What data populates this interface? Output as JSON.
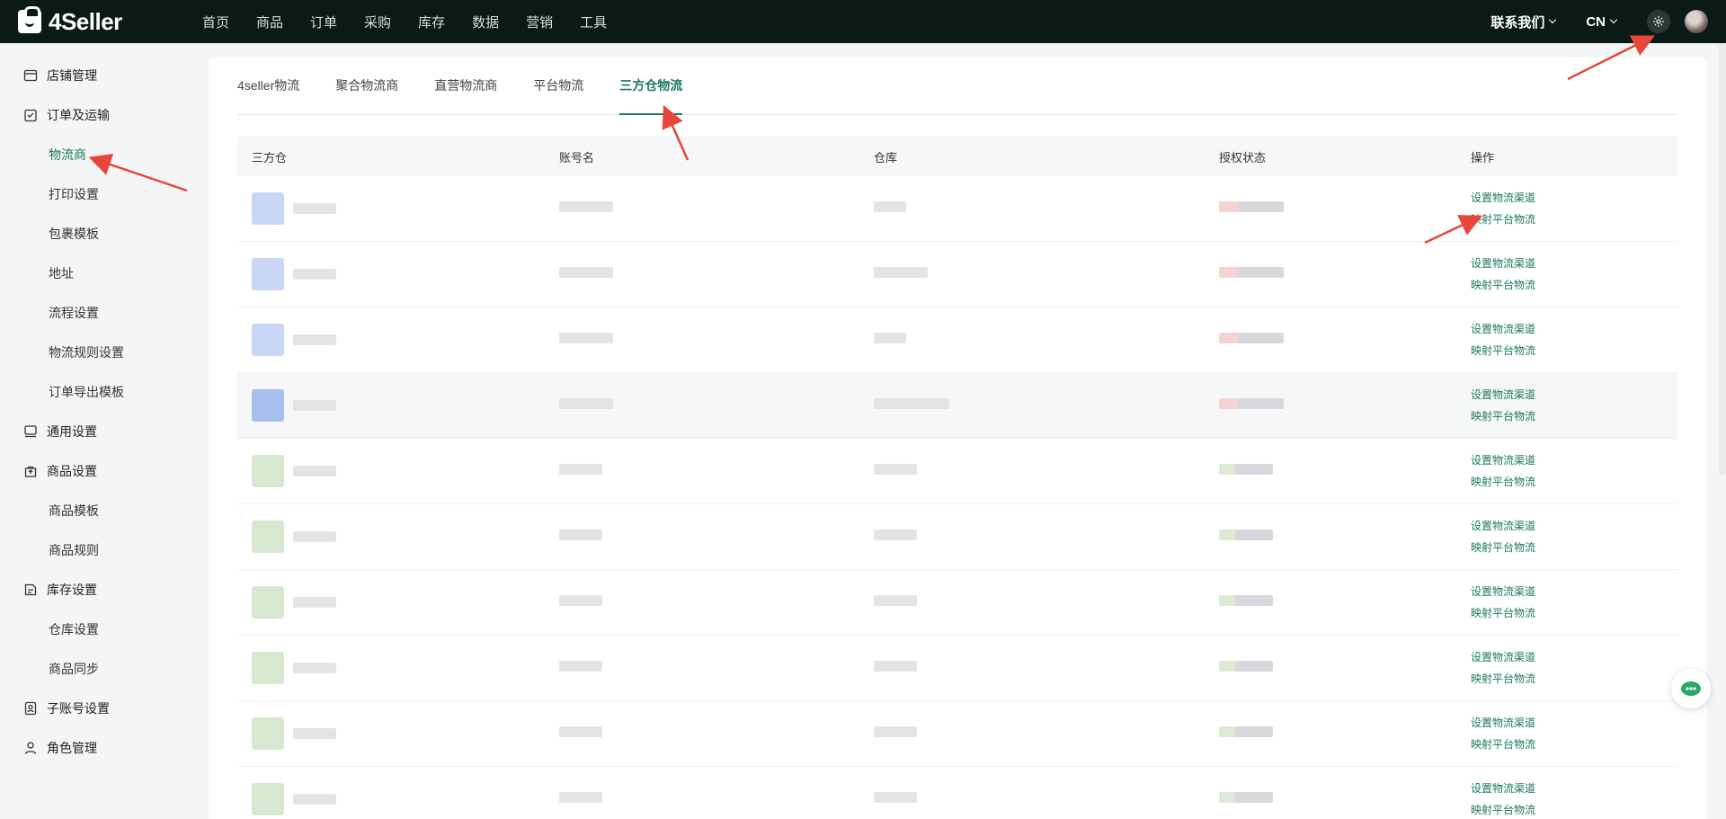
{
  "app": {
    "brand": "4Seller"
  },
  "nav": [
    "首页",
    "商品",
    "订单",
    "采购",
    "库存",
    "数据",
    "营销",
    "工具"
  ],
  "top_right": {
    "contact": "联系我们",
    "lang": "CN"
  },
  "sidebar": {
    "items": [
      {
        "label": "店铺管理",
        "icon": "shop-icon",
        "level": 0
      },
      {
        "label": "订单及运输",
        "icon": "order-icon",
        "level": 0
      },
      {
        "label": "物流商",
        "level": 1,
        "active": true
      },
      {
        "label": "打印设置",
        "level": 1
      },
      {
        "label": "包裹模板",
        "level": 1
      },
      {
        "label": "地址",
        "level": 1
      },
      {
        "label": "流程设置",
        "level": 1
      },
      {
        "label": "物流规则设置",
        "level": 1
      },
      {
        "label": "订单导出模板",
        "level": 1
      },
      {
        "label": "通用设置",
        "icon": "general-icon",
        "level": 0
      },
      {
        "label": "商品设置",
        "icon": "product-icon",
        "level": 0
      },
      {
        "label": "商品模板",
        "level": 1
      },
      {
        "label": "商品规则",
        "level": 1
      },
      {
        "label": "库存设置",
        "icon": "inventory-icon",
        "level": 0
      },
      {
        "label": "仓库设置",
        "level": 1
      },
      {
        "label": "商品同步",
        "level": 1
      },
      {
        "label": "子账号设置",
        "icon": "subaccount-icon",
        "level": 0
      },
      {
        "label": "角色管理",
        "icon": "role-icon",
        "level": 0
      }
    ]
  },
  "tabs": [
    {
      "label": "4seller物流"
    },
    {
      "label": "聚合物流商"
    },
    {
      "label": "直营物流商"
    },
    {
      "label": "平台物流"
    },
    {
      "label": "三方仓物流",
      "active": true
    }
  ],
  "table": {
    "headers": [
      "三方仓",
      "账号名",
      "仓库",
      "授权状态",
      "操作"
    ],
    "actions": {
      "set_channel": "设置物流渠道",
      "map_platform": "映射平台物流"
    },
    "rows": [
      {
        "logo_color": "#c9d6f5",
        "auth_color": "#f5d3d3"
      },
      {
        "logo_color": "#c9d6f5",
        "auth_color": "#f5d3d3"
      },
      {
        "logo_color": "#c9d6f5",
        "auth_color": "#f5d3d3"
      },
      {
        "logo_color": "#a9bff0",
        "auth_color": "#f5d3d3"
      },
      {
        "logo_color": "#d6e8cf",
        "auth_color": "#dcebd6"
      },
      {
        "logo_color": "#d6e8cf",
        "auth_color": "#dcebd6"
      },
      {
        "logo_color": "#d6e8cf",
        "auth_color": "#dcebd6"
      },
      {
        "logo_color": "#d6e8cf",
        "auth_color": "#dcebd6"
      },
      {
        "logo_color": "#d6e8cf",
        "auth_color": "#dcebd6"
      },
      {
        "logo_color": "#d6e8cf",
        "auth_color": "#dcebd6"
      }
    ]
  },
  "colors": {
    "accent": "#1b7a55",
    "topbar": "#0a1a17",
    "annotation_arrow": "#e8463a"
  }
}
